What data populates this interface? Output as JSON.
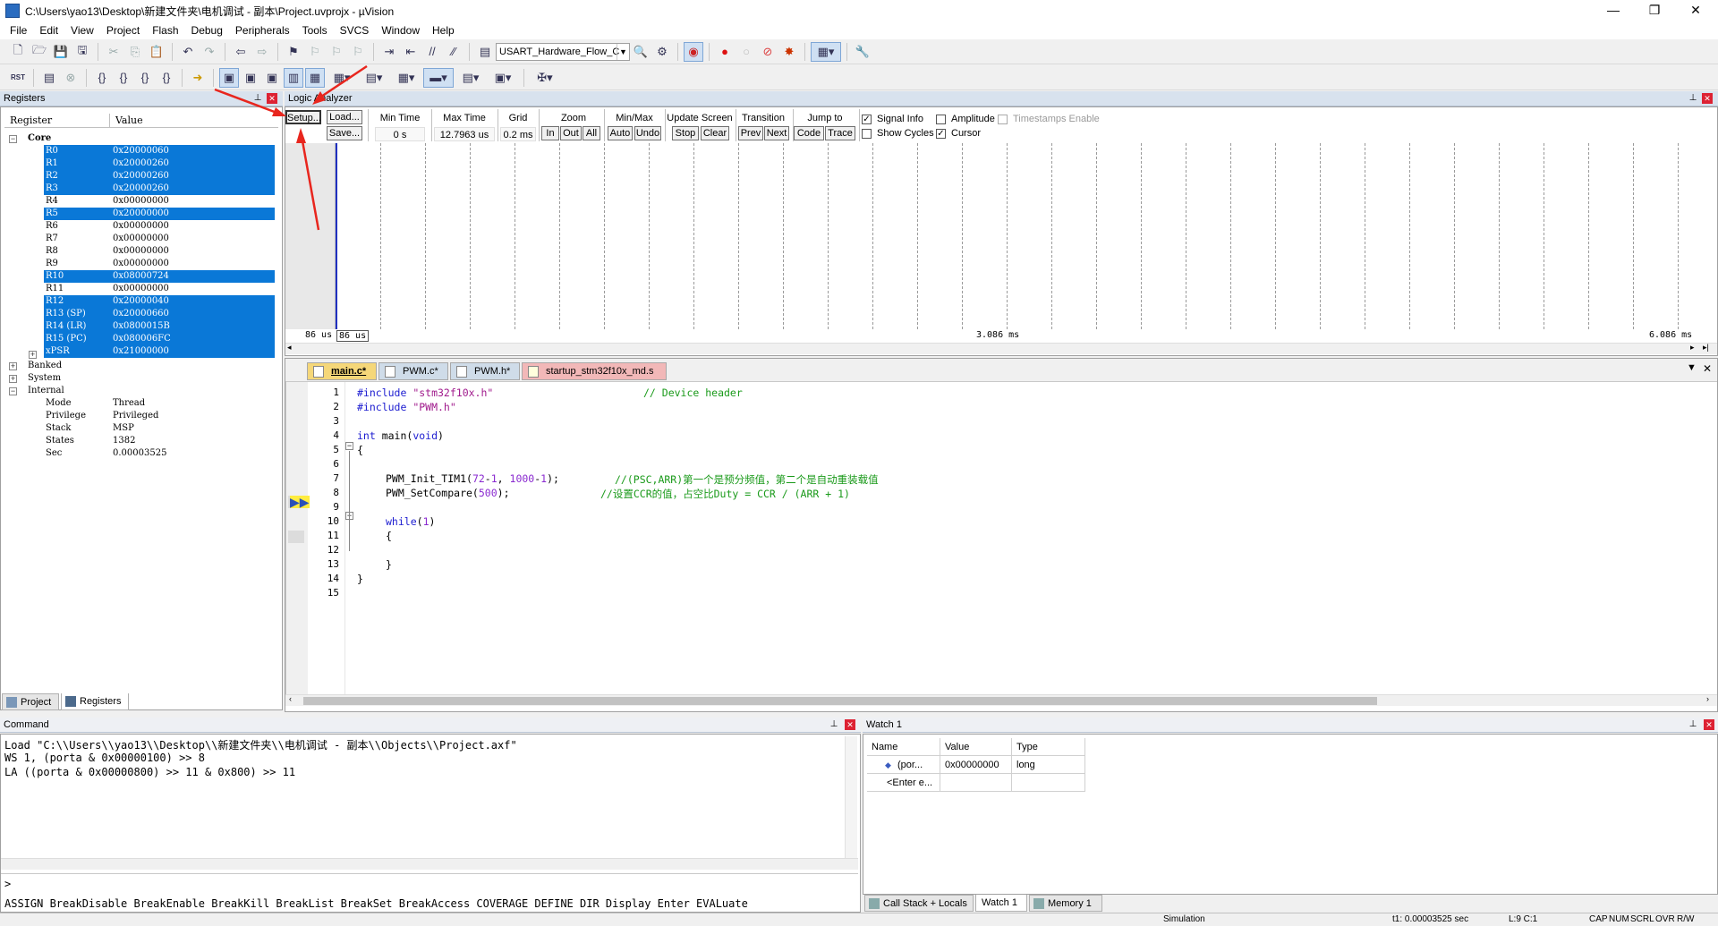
{
  "window": {
    "title": "C:\\Users\\yao13\\Desktop\\新建文件夹\\电机调试 - 副本\\Project.uvprojx - µVision",
    "minimize": "—",
    "maximize": "❐",
    "close": "✕"
  },
  "menu": [
    "File",
    "Edit",
    "View",
    "Project",
    "Flash",
    "Debug",
    "Peripherals",
    "Tools",
    "SVCS",
    "Window",
    "Help"
  ],
  "toolbar": {
    "target_combo": "USART_Hardware_Flow_C"
  },
  "registers": {
    "title": "Registers",
    "col_register": "Register",
    "col_value": "Value",
    "core_label": "Core",
    "core": [
      {
        "name": "R0",
        "value": "0x20000060",
        "selected": true
      },
      {
        "name": "R1",
        "value": "0x20000260",
        "selected": true
      },
      {
        "name": "R2",
        "value": "0x20000260",
        "selected": true
      },
      {
        "name": "R3",
        "value": "0x20000260",
        "selected": true
      },
      {
        "name": "R4",
        "value": "0x00000000",
        "selected": false
      },
      {
        "name": "R5",
        "value": "0x20000000",
        "selected": true
      },
      {
        "name": "R6",
        "value": "0x00000000",
        "selected": false
      },
      {
        "name": "R7",
        "value": "0x00000000",
        "selected": false
      },
      {
        "name": "R8",
        "value": "0x00000000",
        "selected": false
      },
      {
        "name": "R9",
        "value": "0x00000000",
        "selected": false
      },
      {
        "name": "R10",
        "value": "0x08000724",
        "selected": true
      },
      {
        "name": "R11",
        "value": "0x00000000",
        "selected": false
      },
      {
        "name": "R12",
        "value": "0x20000040",
        "selected": true
      },
      {
        "name": "R13 (SP)",
        "value": "0x20000660",
        "selected": true
      },
      {
        "name": "R14 (LR)",
        "value": "0x0800015B",
        "selected": true
      },
      {
        "name": "R15 (PC)",
        "value": "0x080006FC",
        "selected": true
      },
      {
        "name": "xPSR",
        "value": "0x21000000",
        "selected": true
      }
    ],
    "groups": [
      "Banked",
      "System"
    ],
    "internal_label": "Internal",
    "internal": [
      {
        "name": "Mode",
        "value": "Thread"
      },
      {
        "name": "Privilege",
        "value": "Privileged"
      },
      {
        "name": "Stack",
        "value": "MSP"
      },
      {
        "name": "States",
        "value": "1382"
      },
      {
        "name": "Sec",
        "value": "0.00003525"
      }
    ],
    "tabs": [
      "Project",
      "Registers"
    ]
  },
  "logic_analyzer": {
    "title": "Logic Analyzer",
    "setup": "Setup...",
    "load": "Load...",
    "save": "Save...",
    "min_time_label": "Min Time",
    "min_time": "0 s",
    "max_time_label": "Max Time",
    "max_time": "12.7963 us",
    "grid_label": "Grid",
    "grid": "0.2 ms",
    "zoom_label": "Zoom",
    "zoom_in": "In",
    "zoom_out": "Out",
    "zoom_all": "All",
    "minmax_label": "Min/Max",
    "auto": "Auto",
    "undo": "Undo",
    "update_label": "Update Screen",
    "stop": "Stop",
    "clear": "Clear",
    "transition_label": "Transition",
    "prev": "Prev",
    "next": "Next",
    "jump_label": "Jump to",
    "code": "Code",
    "trace": "Trace",
    "signal_info": "Signal Info",
    "show_cycles": "Show Cycles",
    "amplitude": "Amplitude",
    "cursor": "Cursor",
    "timestamps": "Timestamps Enable",
    "signal_info_checked": true,
    "show_cycles_checked": false,
    "amplitude_checked": false,
    "cursor_checked": true,
    "timestamps_checked": false,
    "time_left": "86 us",
    "time_cursor": "86 us",
    "time_mid": "3.086 ms",
    "time_right": "6.086 ms"
  },
  "editor": {
    "tabs": [
      {
        "label": "main.c*",
        "active": true
      },
      {
        "label": "PWM.c*",
        "active": false
      },
      {
        "label": "PWM.h*",
        "active": false
      },
      {
        "label": "startup_stm32f10x_md.s",
        "active": false
      }
    ],
    "line_numbers": [
      "1",
      "2",
      "3",
      "4",
      "5",
      "6",
      "7",
      "8",
      "9",
      "10",
      "11",
      "12",
      "13",
      "14",
      "15"
    ],
    "code": {
      "l1_inc": "#include ",
      "l1_str": "\"stm32f10x.h\"",
      "l1_cmt": "// Device header",
      "l2_inc": "#include ",
      "l2_str": "\"PWM.h\"",
      "l4_kw1": "int",
      "l4_fn": " main(",
      "l4_kw2": "void",
      "l4_end": ")",
      "l5": "{",
      "l7_fn": "PWM_Init_TIM1(",
      "l7_n1": "72",
      "l7_m": "-",
      "l7_n2": "1",
      "l7_c": ", ",
      "l7_n3": "1000",
      "l7_m2": "-",
      "l7_n4": "1",
      "l7_e": ");",
      "l7_cmt": "//(PSC,ARR)第一个是预分频值，第二个是自动重装载值",
      "l8_fn": "PWM_SetCompare(",
      "l8_n": "500",
      "l8_e": ");",
      "l8_cmt": "//设置CCR的值，占空比Duty = CCR / (ARR + 1)",
      "l10_kw": "while",
      "l10_o": "(",
      "l10_n": "1",
      "l10_c": ")",
      "l11": "{",
      "l13": "}",
      "l14": "}"
    }
  },
  "command": {
    "title": "Command",
    "lines": [
      "Load \"C:\\\\Users\\\\yao13\\\\Desktop\\\\新建文件夹\\\\电机调试 - 副本\\\\Objects\\\\Project.axf\"",
      "WS 1, (porta & 0x00000100) >> 8",
      "LA ((porta & 0x00000800) >> 11 & 0x800) >> 11"
    ],
    "prompt": ">",
    "hints": "ASSIGN BreakDisable BreakEnable BreakKill BreakList BreakSet BreakAccess COVERAGE DEFINE DIR Display Enter EVALuate"
  },
  "watch": {
    "title": "Watch 1",
    "col_name": "Name",
    "col_value": "Value",
    "col_type": "Type",
    "rows": [
      {
        "name": "(por...",
        "value": "0x00000000",
        "type": "long"
      },
      {
        "name": "<Enter e...",
        "value": "",
        "type": ""
      }
    ],
    "tabs": [
      "Call Stack + Locals",
      "Watch 1",
      "Memory 1"
    ]
  },
  "status": {
    "mode": "Simulation",
    "t1": "t1: 0.00003525 sec",
    "pos": "L:9 C:1",
    "caps": "CAP",
    "num": "NUM",
    "scrl": "SCRL",
    "ovr": "OVR",
    "rw": "R/W"
  },
  "colors": {
    "selection": "#0a78d7",
    "annotation_arrow": "#e8261e",
    "active_tab": "#f5d779"
  }
}
